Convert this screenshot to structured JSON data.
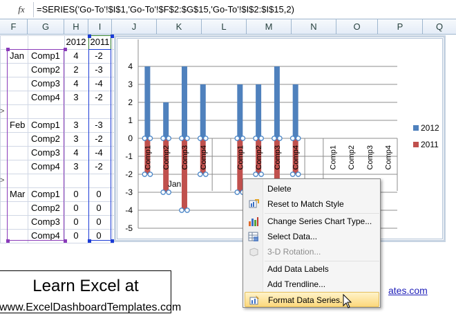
{
  "formula_bar": {
    "fx_label": "fx",
    "formula": "=SERIES('Go-To'!$I$1,'Go-To'!$F$2:$G$15,'Go-To'!$I$2:$I$15,2)"
  },
  "columns": [
    "F",
    "G",
    "H",
    "I",
    "J",
    "K",
    "L",
    "M",
    "N",
    "O",
    "P",
    "Q"
  ],
  "sheet": {
    "header_2012": "2012",
    "header_2011": "2011",
    "rows": [
      {
        "month": "Jan",
        "comp": "Comp1",
        "v2012": "4",
        "v2011": "-2"
      },
      {
        "month": "",
        "comp": "Comp2",
        "v2012": "2",
        "v2011": "-3"
      },
      {
        "month": "",
        "comp": "Comp3",
        "v2012": "4",
        "v2011": "-4"
      },
      {
        "month": "",
        "comp": "Comp4",
        "v2012": "3",
        "v2011": "-2"
      },
      {
        "month": "",
        "comp": "",
        "v2012": "",
        "v2011": ""
      },
      {
        "month": "Feb",
        "comp": "Comp1",
        "v2012": "3",
        "v2011": "-3"
      },
      {
        "month": "",
        "comp": "Comp2",
        "v2012": "3",
        "v2011": "-2"
      },
      {
        "month": "",
        "comp": "Comp3",
        "v2012": "4",
        "v2011": "-4"
      },
      {
        "month": "",
        "comp": "Comp4",
        "v2012": "3",
        "v2011": "-2"
      },
      {
        "month": "",
        "comp": "",
        "v2012": "",
        "v2011": ""
      },
      {
        "month": "Mar",
        "comp": "Comp1",
        "v2012": "0",
        "v2011": "0"
      },
      {
        "month": "",
        "comp": "Comp2",
        "v2012": "0",
        "v2011": "0"
      },
      {
        "month": "",
        "comp": "Comp3",
        "v2012": "0",
        "v2011": "0"
      },
      {
        "month": "",
        "comp": "Comp4",
        "v2012": "0",
        "v2011": "0"
      }
    ]
  },
  "chart_data": {
    "type": "bar",
    "categories": [
      "Comp1",
      "Comp2",
      "Comp3",
      "Comp4",
      "",
      "Comp1",
      "Comp2",
      "Comp3",
      "Comp4",
      "",
      "Comp1",
      "Comp2",
      "Comp3",
      "Comp4"
    ],
    "series": [
      {
        "name": "2012",
        "color": "#4f81bd",
        "values": [
          4,
          2,
          4,
          3,
          null,
          3,
          3,
          4,
          3,
          null,
          0,
          0,
          0,
          0
        ]
      },
      {
        "name": "2011",
        "color": "#c0504d",
        "values": [
          -2,
          -3,
          -4,
          -2,
          null,
          -3,
          -2,
          -4,
          -2,
          null,
          0,
          0,
          0,
          0
        ]
      }
    ],
    "group_labels": [
      "Jan"
    ],
    "ylim": [
      -5,
      5
    ],
    "y_ticks": [
      "4",
      "3",
      "2",
      "1",
      "0",
      "-1",
      "-2",
      "-3",
      "-4",
      "-5"
    ],
    "legend_position": "right",
    "grid": true
  },
  "context_menu": {
    "items": [
      {
        "label": "Delete",
        "icon": "none",
        "disabled": false
      },
      {
        "label": "Reset to Match Style",
        "icon": "reset-style-icon",
        "disabled": false
      },
      {
        "label": "Change Series Chart Type...",
        "icon": "chart-type-icon",
        "disabled": false
      },
      {
        "label": "Select Data...",
        "icon": "select-data-icon",
        "disabled": false
      },
      {
        "label": "3-D Rotation...",
        "icon": "3d-rotation-icon",
        "disabled": true
      },
      {
        "label": "Add Data Labels",
        "icon": "none",
        "disabled": false
      },
      {
        "label": "Add Trendline...",
        "icon": "none",
        "disabled": false
      },
      {
        "label": "Format Data Series...",
        "icon": "format-series-icon",
        "disabled": false,
        "highlighted": true
      }
    ]
  },
  "promo": {
    "title": "Learn Excel at",
    "site": "www.ExcelDashboardTemplates.com",
    "link_fragment": "ates.com"
  }
}
